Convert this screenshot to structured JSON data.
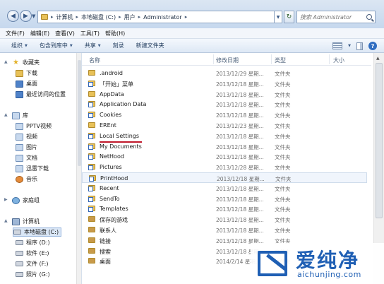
{
  "address": {
    "crumbs": [
      "计算机",
      "本地磁盘 (C:)",
      "用户",
      "Administrator"
    ],
    "search_placeholder": "搜索 Administrator"
  },
  "menu": [
    "文件(F)",
    "编辑(E)",
    "查看(V)",
    "工具(T)",
    "帮助(H)"
  ],
  "toolbar": {
    "organize": "组织",
    "include": "包含到库中",
    "share": "共享",
    "burn": "刻录",
    "new_folder": "新建文件夹"
  },
  "nav": {
    "favorites": {
      "label": "收藏夹",
      "items": [
        "下载",
        "桌面",
        "最近访问的位置"
      ]
    },
    "libraries": {
      "label": "库",
      "items": [
        "PPTV视频",
        "视频",
        "图片",
        "文档",
        "迅雷下载",
        "音乐"
      ]
    },
    "homegroup": "家庭组",
    "computer": {
      "label": "计算机",
      "items": [
        "本地磁盘 (C:)",
        "程序 (D:)",
        "软件 (E:)",
        "文件 (F:)",
        "照片 (G:)"
      ]
    }
  },
  "columns": {
    "name": "名称",
    "date": "修改日期",
    "type": "类型",
    "size": "大小"
  },
  "files": [
    {
      "name": ".android",
      "date": "2013/12/29 星期...",
      "type": "文件夹",
      "icon": "folder"
    },
    {
      "name": "「开始」菜单",
      "date": "2013/12/18 星期...",
      "type": "文件夹",
      "icon": "shortcut-folder"
    },
    {
      "name": "AppData",
      "date": "2013/12/18 星期...",
      "type": "文件夹",
      "icon": "folder"
    },
    {
      "name": "Application Data",
      "date": "2013/12/18 星期...",
      "type": "文件夹",
      "icon": "shortcut-folder"
    },
    {
      "name": "Cookies",
      "date": "2013/12/18 星期...",
      "type": "文件夹",
      "icon": "shortcut-folder"
    },
    {
      "name": "EREnt",
      "date": "2013/12/23 星期...",
      "type": "文件夹",
      "icon": "folder"
    },
    {
      "name": "Local Settings",
      "date": "2013/12/18 星期...",
      "type": "文件夹",
      "icon": "shortcut-folder"
    },
    {
      "name": "My Documents",
      "date": "2013/12/18 星期...",
      "type": "文件夹",
      "icon": "shortcut-folder"
    },
    {
      "name": "NetHood",
      "date": "2013/12/18 星期...",
      "type": "文件夹",
      "icon": "shortcut-folder"
    },
    {
      "name": "Pictures",
      "date": "2013/12/28 星期...",
      "type": "文件夹",
      "icon": "shortcut-folder"
    },
    {
      "name": "PrintHood",
      "date": "2013/12/18 星期...",
      "type": "文件夹",
      "icon": "shortcut-folder"
    },
    {
      "name": "Recent",
      "date": "2013/12/18 星期...",
      "type": "文件夹",
      "icon": "shortcut-folder"
    },
    {
      "name": "SendTo",
      "date": "2013/12/18 星期...",
      "type": "文件夹",
      "icon": "shortcut-folder"
    },
    {
      "name": "Templates",
      "date": "2013/12/18 星期...",
      "type": "文件夹",
      "icon": "shortcut-folder"
    },
    {
      "name": "保存的游戏",
      "date": "2013/12/18 星期...",
      "type": "文件夹",
      "icon": "special-folder"
    },
    {
      "name": "联系人",
      "date": "2013/12/18 星期...",
      "type": "文件夹",
      "icon": "special-folder"
    },
    {
      "name": "链接",
      "date": "2013/12/18 星期...",
      "type": "文件夹",
      "icon": "special-folder"
    },
    {
      "name": "搜索",
      "date": "2013/12/18 星期...",
      "type": "文件夹",
      "icon": "special-folder"
    },
    {
      "name": "桌面",
      "date": "2014/2/14 星期...",
      "type": "文件夹",
      "icon": "special-folder"
    }
  ],
  "watermark": {
    "brand": "爱纯净",
    "url": "aichunjing.com"
  }
}
